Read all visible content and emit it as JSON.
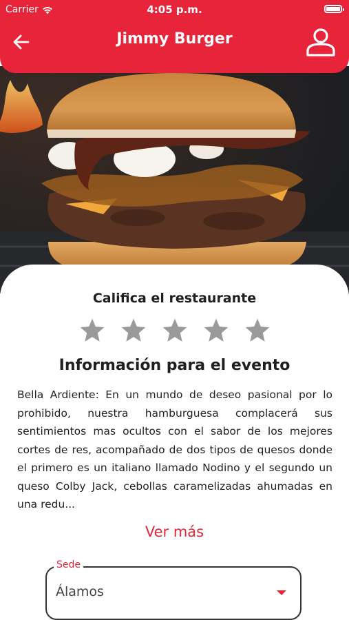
{
  "status_bar": {
    "carrier": "Carrier",
    "time": "4:05 p.m."
  },
  "header": {
    "title": "Jimmy Burger",
    "back_icon": "arrow-left-icon",
    "profile_icon": "user-icon",
    "color": "#E8243A"
  },
  "hero": {
    "image": "burger-photo"
  },
  "rating": {
    "title": "Califica el restaurante",
    "max_stars": 5,
    "selected": 0,
    "star_color": "#9a9a9a"
  },
  "event": {
    "title": "Información para el evento",
    "description": "Bella Ardiente: En un mundo de deseo pasional por lo prohibido, nuestra hamburguesa complacerá sus sentimientos mas ocultos con el sabor de los mejores cortes de res, acompañado de dos tipos de quesos donde el primero es un italiano llamado Nodino y el segundo un queso Colby Jack, cebollas caramelizadas ahumadas en una redu...",
    "see_more": "Ver más"
  },
  "location": {
    "label": "Sede",
    "value": "Álamos"
  }
}
